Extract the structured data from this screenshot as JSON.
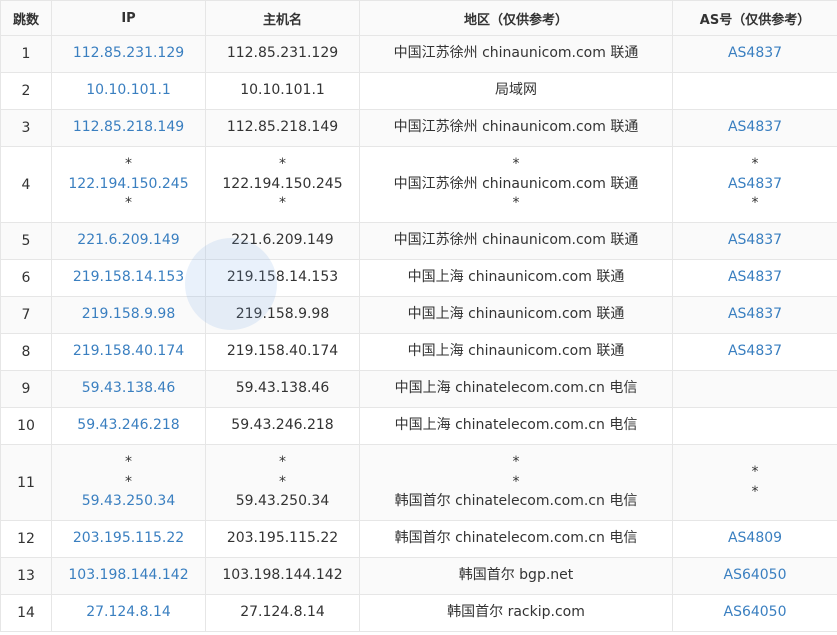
{
  "headers": [
    "跳数",
    "IP",
    "主机名",
    "地区（仅供参考）",
    "AS号（仅供参考）"
  ],
  "rows": [
    {
      "hop": "1",
      "ip": [
        "112.85.231.129"
      ],
      "host": [
        "112.85.231.129"
      ],
      "region": [
        "中国江苏徐州 chinaunicom.com 联通"
      ],
      "asn": [
        "AS4837"
      ]
    },
    {
      "hop": "2",
      "ip": [
        "10.10.101.1"
      ],
      "host": [
        "10.10.101.1"
      ],
      "region": [
        "局域网"
      ],
      "asn": [
        ""
      ]
    },
    {
      "hop": "3",
      "ip": [
        "112.85.218.149"
      ],
      "host": [
        "112.85.218.149"
      ],
      "region": [
        "中国江苏徐州 chinaunicom.com 联通"
      ],
      "asn": [
        "AS4837"
      ]
    },
    {
      "hop": "4",
      "ip": [
        "*",
        "122.194.150.245",
        "*"
      ],
      "host": [
        "*",
        "122.194.150.245",
        "*"
      ],
      "region": [
        "*",
        "中国江苏徐州 chinaunicom.com 联通",
        "*"
      ],
      "asn": [
        "*",
        "AS4837",
        "*"
      ]
    },
    {
      "hop": "5",
      "ip": [
        "221.6.209.149"
      ],
      "host": [
        "221.6.209.149"
      ],
      "region": [
        "中国江苏徐州 chinaunicom.com 联通"
      ],
      "asn": [
        "AS4837"
      ]
    },
    {
      "hop": "6",
      "ip": [
        "219.158.14.153"
      ],
      "host": [
        "219.158.14.153"
      ],
      "region": [
        "中国上海 chinaunicom.com 联通"
      ],
      "asn": [
        "AS4837"
      ]
    },
    {
      "hop": "7",
      "ip": [
        "219.158.9.98"
      ],
      "host": [
        "219.158.9.98"
      ],
      "region": [
        "中国上海 chinaunicom.com 联通"
      ],
      "asn": [
        "AS4837"
      ]
    },
    {
      "hop": "8",
      "ip": [
        "219.158.40.174"
      ],
      "host": [
        "219.158.40.174"
      ],
      "region": [
        "中国上海 chinaunicom.com 联通"
      ],
      "asn": [
        "AS4837"
      ]
    },
    {
      "hop": "9",
      "ip": [
        "59.43.138.46"
      ],
      "host": [
        "59.43.138.46"
      ],
      "region": [
        "中国上海 chinatelecom.com.cn 电信"
      ],
      "asn": [
        ""
      ]
    },
    {
      "hop": "10",
      "ip": [
        "59.43.246.218"
      ],
      "host": [
        "59.43.246.218"
      ],
      "region": [
        "中国上海 chinatelecom.com.cn 电信"
      ],
      "asn": [
        ""
      ]
    },
    {
      "hop": "11",
      "ip": [
        "*",
        "*",
        "59.43.250.34"
      ],
      "host": [
        "*",
        "*",
        "59.43.250.34"
      ],
      "region": [
        "*",
        "*",
        "韩国首尔 chinatelecom.com.cn 电信"
      ],
      "asn": [
        "*",
        "*",
        ""
      ]
    },
    {
      "hop": "12",
      "ip": [
        "203.195.115.22"
      ],
      "host": [
        "203.195.115.22"
      ],
      "region": [
        "韩国首尔 chinatelecom.com.cn 电信"
      ],
      "asn": [
        "AS4809"
      ]
    },
    {
      "hop": "13",
      "ip": [
        "103.198.144.142"
      ],
      "host": [
        "103.198.144.142"
      ],
      "region": [
        "韩国首尔 bgp.net"
      ],
      "asn": [
        "AS64050"
      ]
    },
    {
      "hop": "14",
      "ip": [
        "27.124.8.14"
      ],
      "host": [
        "27.124.8.14"
      ],
      "region": [
        "韩国首尔 rackip.com"
      ],
      "asn": [
        "AS64050"
      ]
    }
  ],
  "colors": {
    "link": "#3a7fc0",
    "text": "#333333",
    "border": "#e6e6e6"
  }
}
